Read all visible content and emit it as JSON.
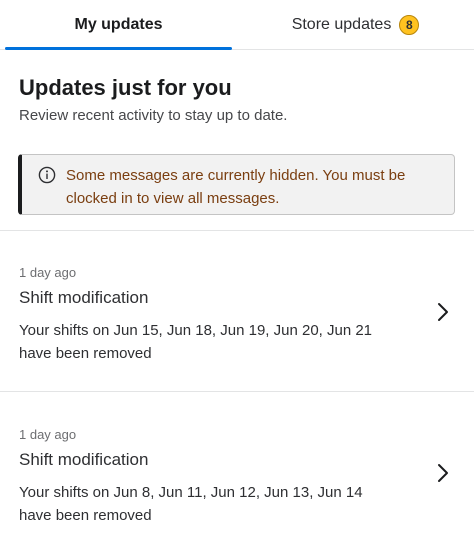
{
  "tabs": [
    {
      "label": "My updates",
      "active": true
    },
    {
      "label": "Store updates",
      "badge": "8",
      "active": false
    }
  ],
  "header": {
    "title": "Updates just for you",
    "subtitle": "Review recent activity to stay up to date."
  },
  "alert": {
    "icon": "info-icon",
    "text": "Some messages are currently hidden. You must be clocked in to view all messages."
  },
  "updates": [
    {
      "time": "1 day ago",
      "title": "Shift modification",
      "body": "Your shifts on Jun 15, Jun 18, Jun 19, Jun 20, Jun 21 have been removed",
      "icon": "chevron-right-icon"
    },
    {
      "time": "1 day ago",
      "title": "Shift modification",
      "body": "Your shifts on Jun 8, Jun 11, Jun 12, Jun 13, Jun 14 have been removed",
      "icon": "chevron-right-icon"
    }
  ],
  "colors": {
    "accent": "#0071dc",
    "badge": "#ffc220",
    "alert_text": "#7a3e10"
  }
}
